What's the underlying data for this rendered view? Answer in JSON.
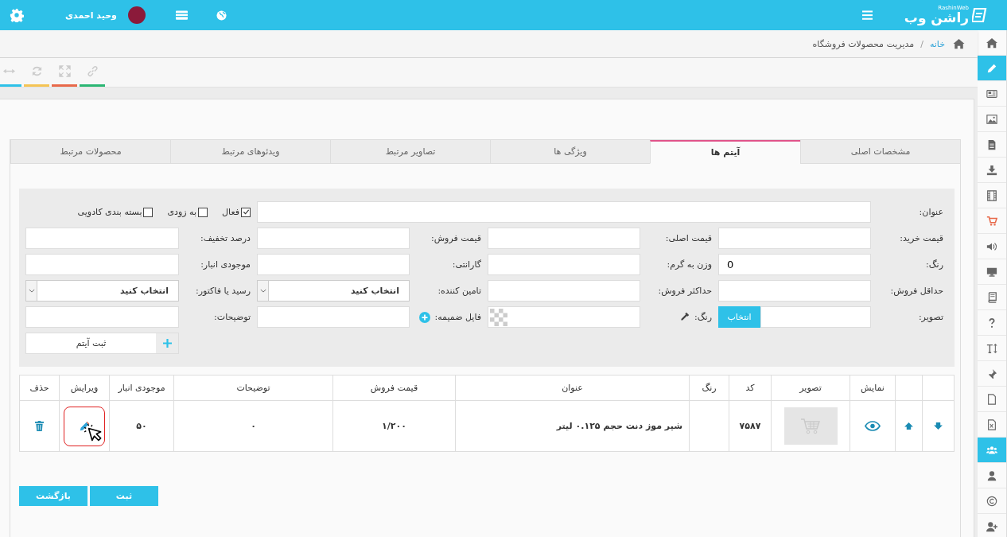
{
  "top_bar": {
    "logo_text": "راشن وب",
    "logo_subtext": "RashinWeb",
    "user_name": "وحید احمدی"
  },
  "breadcrumb": {
    "items": [
      {
        "label": "خانه",
        "kind": "link"
      },
      {
        "label": "مدیریت محصولات فروشگاه",
        "kind": "current"
      }
    ],
    "separator": "/"
  },
  "toolbar": [
    {
      "color": "#2bb673"
    },
    {
      "color": "#e8694a"
    },
    {
      "color": "#f5c454"
    },
    {
      "color": "#2ec1e8"
    }
  ],
  "sidebar": {
    "items": [
      {
        "selected": false
      },
      {
        "selected": true
      },
      {
        "selected": false
      },
      {
        "selected": false
      },
      {
        "selected": false
      },
      {
        "selected": false
      },
      {
        "selected": false
      },
      {
        "selected": false
      },
      {
        "selected": false
      },
      {
        "selected": false
      },
      {
        "selected": false
      },
      {
        "selected": false
      },
      {
        "selected": false
      },
      {
        "selected": false
      },
      {
        "selected": false
      },
      {
        "selected": false
      },
      {
        "selected": true
      },
      {
        "selected": false
      },
      {
        "selected": false
      },
      {
        "selected": false
      }
    ]
  },
  "tabs": [
    {
      "label": "مشخصات اصلی",
      "selected": false
    },
    {
      "label": "آیتم ها",
      "selected": true
    },
    {
      "label": "ویژگی ها",
      "selected": false
    },
    {
      "label": "تصاویر مرتبط",
      "selected": false
    },
    {
      "label": "ویدئوهای مرتبط",
      "selected": false
    },
    {
      "label": "محصولات مرتبط",
      "selected": false
    }
  ],
  "form": {
    "title_label": "عنوان:",
    "flags": [
      {
        "label": "فعال",
        "checked": true
      },
      {
        "label": "به زودی",
        "checked": false
      },
      {
        "label": "بسته بندی کادویی",
        "checked": false
      }
    ],
    "rows": [
      [
        {
          "kind": "label",
          "text": "قیمت خرید:"
        },
        {
          "kind": "input"
        },
        {
          "kind": "label",
          "text": "قیمت اصلی:"
        },
        {
          "kind": "input"
        },
        {
          "kind": "label",
          "text": "قیمت فروش:"
        },
        {
          "kind": "input"
        },
        {
          "kind": "label",
          "text": "درصد تخفیف:"
        },
        {
          "kind": "input"
        }
      ],
      [
        {
          "kind": "label",
          "text": "رنگ:"
        },
        {
          "kind": "input",
          "value": "0"
        },
        {
          "kind": "label",
          "text": "وزن به گرم:"
        },
        {
          "kind": "input"
        },
        {
          "kind": "label",
          "text": "گارانتی:"
        },
        {
          "kind": "input"
        },
        {
          "kind": "label",
          "text": "موجودی انبار:"
        },
        {
          "kind": "input"
        }
      ],
      [
        {
          "kind": "label",
          "text": "حداقل فروش:"
        },
        {
          "kind": "input"
        },
        {
          "kind": "label",
          "text": "حداکثر فروش:"
        },
        {
          "kind": "input"
        },
        {
          "kind": "label",
          "text": "تامین کننده:"
        },
        {
          "kind": "select",
          "value": "انتخاب کنید"
        },
        {
          "kind": "label",
          "text": "رسید یا فاکتور:"
        },
        {
          "kind": "select",
          "value": "انتخاب کنید"
        }
      ],
      [
        {
          "kind": "label",
          "text": "تصویر:"
        },
        {
          "kind": "image_input",
          "button": "انتخاب"
        },
        {
          "kind": "label_picker",
          "text": "رنگ:"
        },
        {
          "kind": "color_input"
        },
        {
          "kind": "label_add",
          "text": "فایل ضمیمه:"
        },
        {
          "kind": "input"
        },
        {
          "kind": "label",
          "text": "توضیحات:"
        },
        {
          "kind": "input"
        }
      ]
    ],
    "add_button": "ثبت آیتم"
  },
  "table": {
    "columns": [
      {
        "kind": "move_down"
      },
      {
        "kind": "move_up"
      },
      {
        "kind": "view",
        "label": "نمایش"
      },
      {
        "kind": "image",
        "label": "تصویر"
      },
      {
        "kind": "text",
        "label": "کد"
      },
      {
        "kind": "color",
        "label": "رنگ"
      },
      {
        "kind": "title",
        "label": "عنوان"
      },
      {
        "kind": "text",
        "label": "قیمت فروش"
      },
      {
        "kind": "text",
        "label": "توضیحات"
      },
      {
        "kind": "text",
        "label": "موجودی انبار"
      },
      {
        "kind": "edit",
        "label": "ویرایش"
      },
      {
        "kind": "delete",
        "label": "حذف"
      }
    ],
    "rows": [
      {
        "texts": [
          "۷۵۸۷",
          "شیر موز دنت حجم ۰.۱۲۵ لیتر",
          "۱/۲۰۰",
          "۰",
          "۵۰"
        ],
        "edit_highlighted": true
      }
    ]
  },
  "buttons": [
    {
      "label": "ثبت"
    },
    {
      "label": "بازگشت"
    }
  ]
}
